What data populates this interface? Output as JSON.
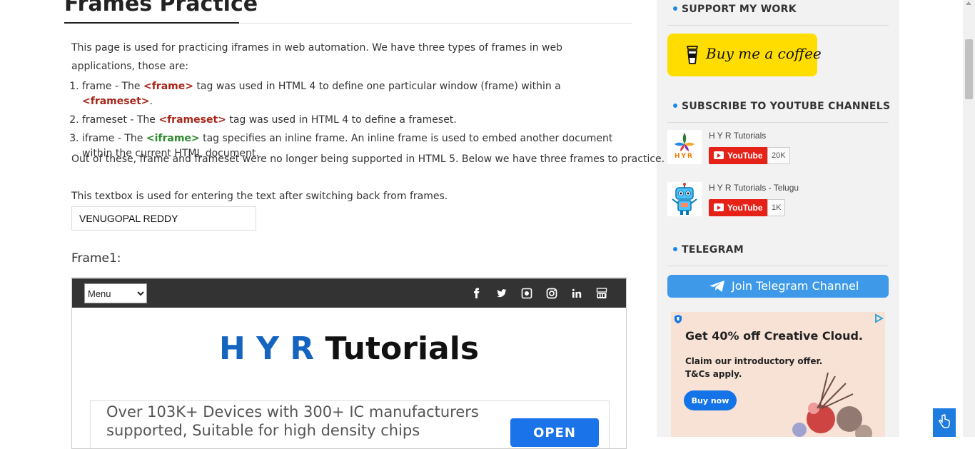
{
  "page": {
    "title": "Frames Practice",
    "intro": "This page is used for practicing iframes in web automation. We have three types of frames in web applications, those are:",
    "frame_types": [
      {
        "prefix": "frame - The ",
        "tag": "<frame>",
        "suffix": " tag was used in HTML 4 to define one particular window (frame) within a ",
        "tag2": "<frameset>",
        "suffix2": "."
      },
      {
        "prefix": "frameset - The ",
        "tag": "<frameset>",
        "suffix": " tag was used in HTML 4 to define a frameset."
      },
      {
        "prefix": "iframe - The ",
        "tag": "<iframe>",
        "suffix": " tag specifies an inline frame. An inline frame is used to embed another document within the current HTML document."
      }
    ],
    "outro": "Out of these, frame and frameset were no longer being supported in HTML 5. Below we have three frames to practice.",
    "textbox_caption": "This textbox is used for entering the text after switching back from frames.",
    "textbox_value": "VENUGOPAL REDDY",
    "frame1_label": "Frame1:"
  },
  "frame1": {
    "menu_selected": "Menu",
    "social_icons": [
      "facebook-icon",
      "twitter-icon",
      "github-icon",
      "instagram-icon",
      "linkedin-icon",
      "youtube-icon"
    ],
    "brand_part1": "H Y R",
    "brand_part2": "Tutorials",
    "ad_text": "Over 103K+ Devices with 300+ IC manufacturers supported, Suitable for high density chips",
    "ad_button": "OPEN"
  },
  "sidebar": {
    "support_title": "SUPPORT MY WORK",
    "coffee_label": "Buy me a coffee",
    "subscribe_title": "SUBSCRIBE TO YOUTUBE CHANNELS",
    "channels": [
      {
        "name": "H Y R Tutorials",
        "button": "YouTube",
        "count": "20K",
        "avatar_text": "HYR"
      },
      {
        "name": "H Y R Tutorials - Telugu",
        "button": "YouTube",
        "count": "1K"
      }
    ],
    "telegram_title": "TELEGRAM",
    "telegram_button": "Join Telegram Channel",
    "ad": {
      "headline": "Get 40% off Creative Cloud.",
      "sub": "Claim our introductory offer. T&Cs apply.",
      "button": "Buy now"
    }
  },
  "colors": {
    "accent_blue": "#1e88e5",
    "tag_red": "#a8261a",
    "tag_green": "#2d8a2d",
    "coffee_yellow": "#ffdd00",
    "youtube_red": "#e62117",
    "telegram_blue": "#3e9ae8"
  }
}
